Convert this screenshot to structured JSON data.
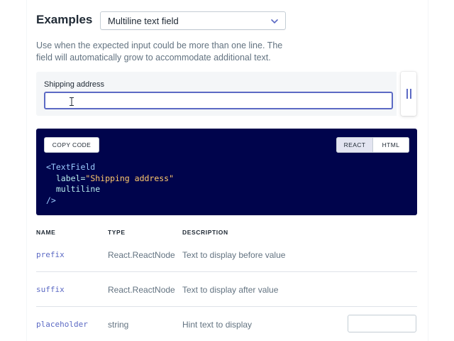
{
  "header": {
    "title": "Examples",
    "select_value": "Multiline text field"
  },
  "description": "Use when the expected input could be more than one line. The field will automatically grow to accommodate additional text.",
  "example": {
    "label": "Shipping address",
    "value": ""
  },
  "code_panel": {
    "copy_label": "COPY CODE",
    "tabs": [
      {
        "label": "REACT",
        "active": true
      },
      {
        "label": "HTML",
        "active": false
      }
    ],
    "lines": {
      "open_tag": "<TextField",
      "label_attr": "label=",
      "label_value": "\"Shipping address\"",
      "multiline": "multiline",
      "close": "/>"
    }
  },
  "props_table": {
    "headers": [
      "NAME",
      "TYPE",
      "DESCRIPTION"
    ],
    "rows": [
      {
        "name": "prefix",
        "type": "React.ReactNode",
        "description": "Text to display before value"
      },
      {
        "name": "suffix",
        "type": "React.ReactNode",
        "description": "Text to display after value"
      },
      {
        "name": "placeholder",
        "type": "string",
        "description": "Hint text to display"
      }
    ]
  },
  "colors": {
    "accent": "#5c6ac4",
    "code_background": "#00044c",
    "muted_text": "#637381"
  }
}
